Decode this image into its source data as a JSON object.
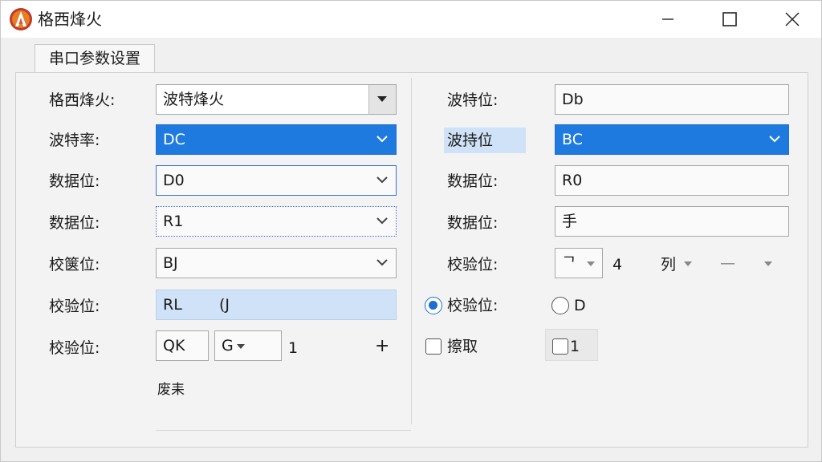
{
  "window": {
    "title": "格西烽火",
    "icons": {
      "app": "flame-logo-icon",
      "minimize": "minimize-icon",
      "maximize": "maximize-icon",
      "close": "close-icon"
    }
  },
  "tab": {
    "label": "串口参数设置"
  },
  "left": {
    "rows": [
      {
        "label": "格西烽火:",
        "value": "波特烽火"
      },
      {
        "label": "波特率:",
        "value": "DC"
      },
      {
        "label": "数据位:",
        "value": "D0"
      },
      {
        "label": "数据位:",
        "value": "R1"
      },
      {
        "label": "校箧位:",
        "value": "BJ"
      },
      {
        "label": "校验位:",
        "value": "RL",
        "value2": "(J"
      },
      {
        "label": "校验位:",
        "box1": "QK",
        "box2": "G",
        "value": "1",
        "plus": "+"
      }
    ],
    "footer_text": "废耒"
  },
  "right": {
    "rows": [
      {
        "label": "波特位:",
        "value": "Db"
      },
      {
        "label": "波持位",
        "value": "BC"
      },
      {
        "label": "数据位:",
        "value": "R0"
      },
      {
        "label": "数据位:",
        "value": "手"
      },
      {
        "label": "校验位:",
        "glyph": "ᄀ",
        "number": "4",
        "col_label": "列",
        "dash": "—"
      },
      {
        "radio1_label": "校验位:",
        "radio2_label": "D"
      },
      {
        "check1_label": "擦取",
        "check2_label": "1"
      }
    ]
  },
  "colors": {
    "accent": "#1f7ae0",
    "highlight": "#cfe2f7"
  }
}
